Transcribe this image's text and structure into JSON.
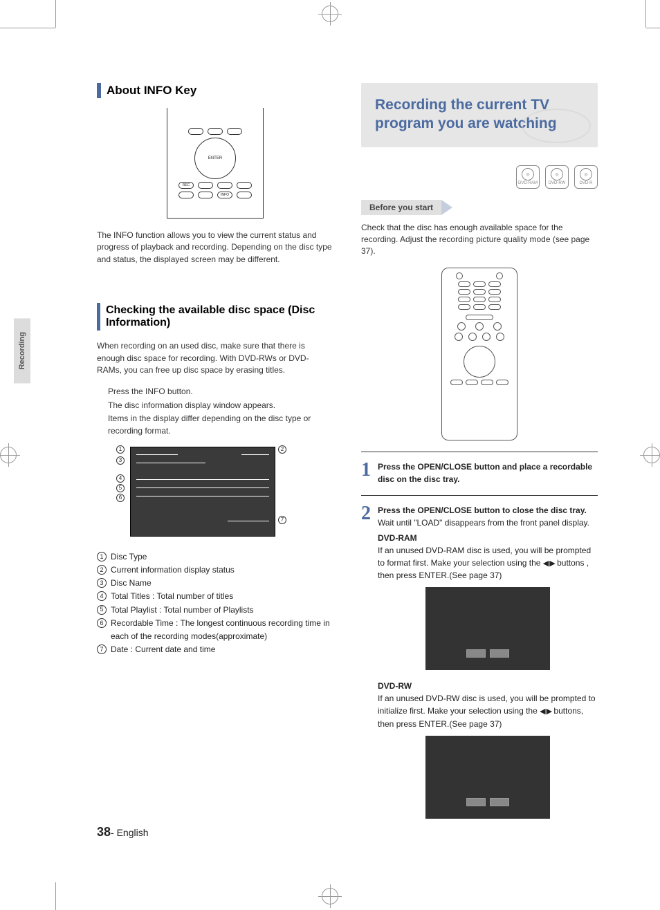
{
  "sidebar": {
    "tab_label": "Recording"
  },
  "left": {
    "heading1": "About INFO Key",
    "remote_center": "ENTER",
    "para1": "The INFO function allows you to view the current status and progress of playback and recording. Depending on the disc type and status, the displayed screen may be different.",
    "heading2": "Checking the available disc space (Disc Information)",
    "para2": "When recording on an used disc, make sure that there is enough disc space for recording. With DVD-RWs or DVD-RAMs, you can free up disc space by erasing titles.",
    "press_info": "Press the INFO button.",
    "window_appears": "The disc information display window appears.",
    "items_differ": "Items in the display differ depending on the disc type or recording format.",
    "legend": [
      "Disc Type",
      "Current information display status",
      "Disc Name",
      "Total Titles : Total number of titles",
      "Total Playlist : Total number of Playlists",
      "Recordable Time : The longest continuous recording time in each of the recording modes(approximate)",
      "Date : Current date and time"
    ]
  },
  "right": {
    "banner_title": "Recording the current TV program you are watching",
    "disc_labels": [
      "DVD-RAM",
      "DVD-RW",
      "DVD-R"
    ],
    "before_start_label": "Before you start",
    "before_start_text": "Check that the disc has enough available space for the recording. Adjust the recording picture quality mode (see page 37).",
    "step1": "Press the OPEN/CLOSE button and place a recordable disc on the disc tray.",
    "step2_bold": "Press the OPEN/CLOSE button to close the disc tray.",
    "step2_wait": "Wait until \"LOAD\" disappears from the front panel display.",
    "step2_ram_label": "DVD-RAM",
    "step2_ram_text": "If an unused DVD-RAM disc is used, you will be prompted to format first. Make your selection using the ",
    "step2_ram_tail": " buttons , then press ENTER.(See page 37)",
    "step2_rw_label": "DVD-RW",
    "step2_rw_text": "If an unused DVD-RW disc is used, you will be prompted to initialize first. Make your selection using the ",
    "step2_rw_tail": " buttons, then press ENTER.(See page 37)"
  },
  "footer": {
    "page": "38",
    "lang": "- English"
  }
}
